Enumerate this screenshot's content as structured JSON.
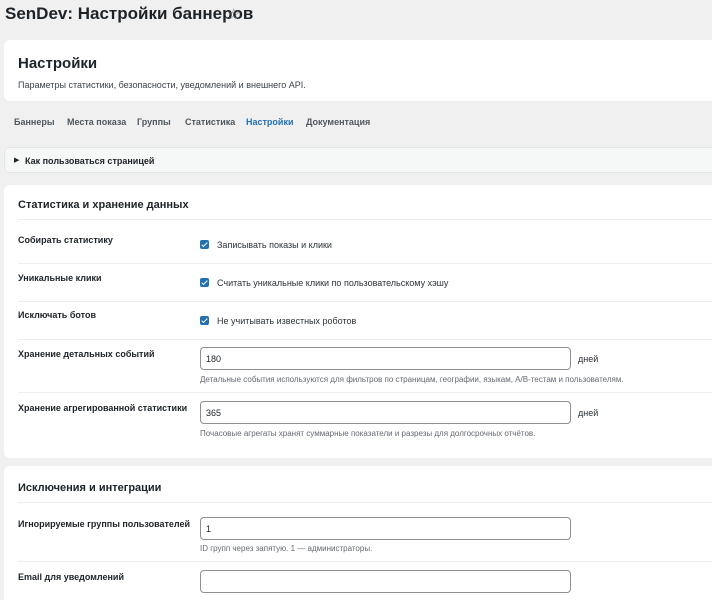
{
  "page": {
    "title": "SenDev: Настройки баннеров",
    "star_icon": "star-icon"
  },
  "hero": {
    "title": "Настройки",
    "subtitle": "Параметры статистики, безопасности, уведомлений и внешнего API."
  },
  "tabs": [
    {
      "label": "Баннеры",
      "active": false
    },
    {
      "label": "Места показа",
      "active": false
    },
    {
      "label": "Группы",
      "active": false
    },
    {
      "label": "Статистика",
      "active": false
    },
    {
      "label": "Настройки",
      "active": true
    },
    {
      "label": "Документация",
      "active": false
    }
  ],
  "how_to": {
    "label": "Как пользоваться страницей",
    "icon": "triangle-right-icon"
  },
  "stats_section": {
    "title": "Статистика и хранение данных",
    "collect": {
      "label": "Собирать статистику",
      "checkbox_label": "Записывать показы и клики",
      "checked": true
    },
    "unique": {
      "label": "Уникальные клики",
      "checkbox_label": "Считать уникальные клики по пользовательскому хэшу",
      "checked": true
    },
    "bots": {
      "label": "Исключать ботов",
      "checkbox_label": "Не учитывать известных роботов",
      "checked": true
    },
    "detail_retention": {
      "label": "Хранение детальных событий",
      "value": "180",
      "unit": "дней",
      "help": "Детальные события используются для фильтров по страницам, географии, языкам, A/B-тестам и пользователям."
    },
    "agg_retention": {
      "label": "Хранение агрегированной статистики",
      "value": "365",
      "unit": "дней",
      "help": "Почасовые агрегаты хранят суммарные показатели и разрезы для долгосрочных отчётов."
    }
  },
  "exclusions_section": {
    "title": "Исключения и интеграции",
    "ignored_groups": {
      "label": "Игнорируемые группы пользователей",
      "value": "1",
      "help": "ID групп через запятую. 1 — администраторы."
    },
    "email": {
      "label": "Email для уведомлений",
      "value": ""
    }
  },
  "colors": {
    "accent": "#2271b1",
    "background": "#f0f0f1"
  }
}
